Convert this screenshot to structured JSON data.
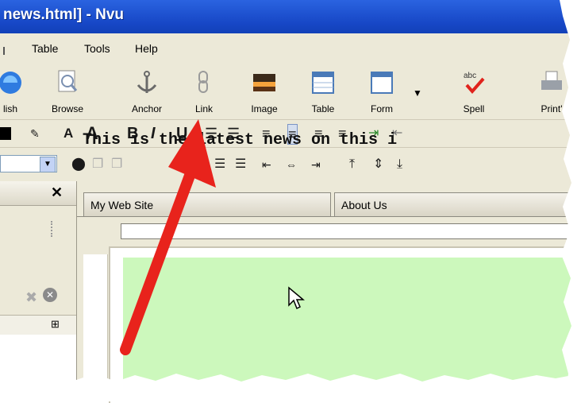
{
  "window": {
    "title": "news.html] - Nvu"
  },
  "menu": {
    "items": [
      "Table",
      "Tools",
      "Help"
    ]
  },
  "toolbar": {
    "buttons": [
      {
        "label": "lish",
        "icon": "publish-icon"
      },
      {
        "label": "Browse",
        "icon": "browse-icon"
      },
      {
        "label": "Anchor",
        "icon": "anchor-icon"
      },
      {
        "label": "Link",
        "icon": "link-icon"
      },
      {
        "label": "Image",
        "icon": "image-icon"
      },
      {
        "label": "Table",
        "icon": "table-icon"
      },
      {
        "label": "Form",
        "icon": "form-icon"
      },
      {
        "label": "Spell",
        "icon": "spell-icon"
      },
      {
        "label": "Print'",
        "icon": "print-icon"
      }
    ],
    "spell_badge": "abc"
  },
  "format": {
    "bold": "B",
    "italic": "I",
    "underline": "U",
    "font_smaller": "A",
    "font_larger": "A"
  },
  "tabs": [
    "My Web Site",
    "About Us"
  ],
  "document": {
    "text": "This is the latest news on this i"
  },
  "colors": {
    "titlebar": "#1747c6",
    "chrome": "#ece9d8",
    "page_background": "#ccf8bc",
    "annotation_arrow": "#e8231c"
  }
}
